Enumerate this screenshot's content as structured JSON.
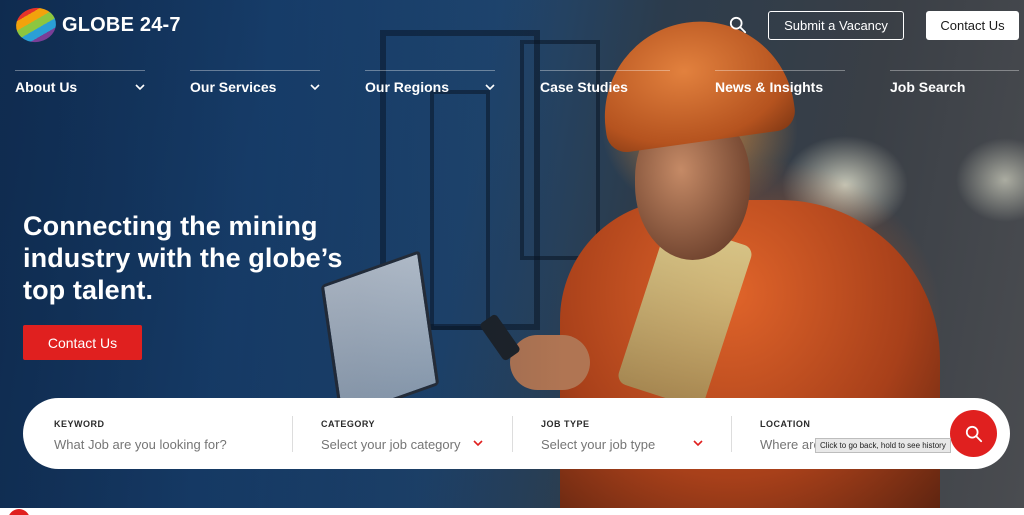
{
  "brand": {
    "name": "GLOBE 24-7"
  },
  "header": {
    "search_icon": "search-icon",
    "submit_vacancy_label": "Submit a Vacancy",
    "contact_label": "Contact Us"
  },
  "nav": {
    "items": [
      {
        "label": "About Us",
        "has_dropdown": true
      },
      {
        "label": "Our Services",
        "has_dropdown": true
      },
      {
        "label": "Our Regions",
        "has_dropdown": true
      },
      {
        "label": "Case Studies",
        "has_dropdown": false
      },
      {
        "label": "News & Insights",
        "has_dropdown": false
      },
      {
        "label": "Job Search",
        "has_dropdown": false
      }
    ]
  },
  "hero": {
    "title_lines": [
      "Connecting the mining",
      "industry with the globe’s",
      "top talent."
    ],
    "cta_label": "Contact Us"
  },
  "job_search": {
    "keyword": {
      "label": "KEYWORD",
      "placeholder": "What Job are you looking for?"
    },
    "category": {
      "label": "CATEGORY",
      "placeholder": "Select your job category"
    },
    "job_type": {
      "label": "JOB TYPE",
      "placeholder": "Select your job type"
    },
    "location": {
      "label": "LOCATION",
      "placeholder": "Where are"
    },
    "search_button_icon": "search-icon"
  },
  "tooltip": {
    "text": "Click to go back, hold to see history"
  },
  "colors": {
    "accent_red": "#e0201f",
    "white": "#ffffff",
    "hero_blue": "#1c4a7d",
    "jacket_orange": "#d45a24"
  }
}
